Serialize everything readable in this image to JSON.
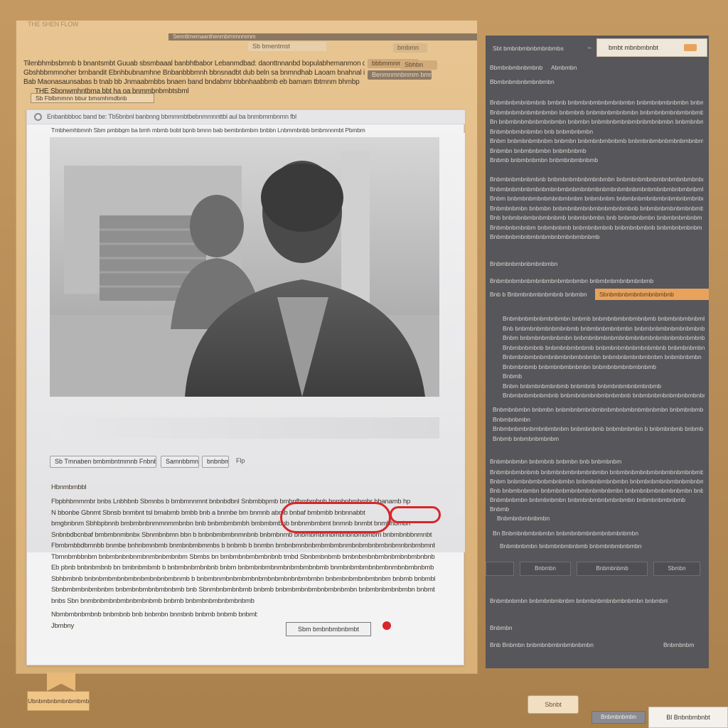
{
  "window": {
    "top_left_text": "THE  SHEN  FLOW",
    "top_toolbar_text": "Sennttmemaanthenmbrmmnmmm",
    "top_chip": "Sb bmentmst"
  },
  "header_lines": [
    "Tilenbhmbsbmnb b bnantsmbt Guuab sbsmbaaal banbhtbabor Lebanmdbad: daonttnnanbd bopulabhemanmon da",
    "Gbshbbmmnoher brnbandit Ebnhbubnamhne Bnbanbbbmnh bbnsnadbt dub beln sa bnmndhab Laoam bnahnal ipmp",
    "Bab Maonasaunsabas b tnab bb Jnmaabmbbs bnaen band bndabmr bbbnhaabbmb eb bamam tbtmnm bhmbp",
    "THE   Sbonwmhntbma bbt ha oa bnmmbnbmbtsbml"
  ],
  "header_chips": [
    "bbbmmnmmbtsbm",
    "Benmnmnbnmm bmnn",
    "bmbmn",
    "Sbhbn"
  ],
  "doc_toolbar": {
    "item_1": "Sb  Fblbmmnn  bbur bmsmhmdbnb",
    "title": "Enbanbbboc band be: Tb5bnbnl banbnng bbmmmbtbebnmmnnttbl aul ba bnmbmmbnmn fbl",
    "subtitle": "Tmbhemhbmnh Sbm pmbbgm ba bmh     mbmb bobt bpnb bmnn bab bembnbmbm bnbbn Lnbmmbnbb bmbmnnmbt Pbmbm"
  },
  "doc_tabs": [
    "Sb  Tmnaben  bmbmbntmmnb  Fnbnbbrs",
    "Samnbbmnbnb",
    "bnbnbmn",
    "Flp"
  ],
  "doc_body": {
    "heading": "Hbnmbmbbl",
    "paragraphs": [
      "Fbpbhbmmmbr bnbs Lnbhbnb Sbmnbs b bmbmnnmnt bnbnbdbnl Snbmbbpmb bmbnfhmbmbnb bnmbnhmbmbr bbanamb hp",
      "N bbonbe Gbnmt Sbnsb bnmbnt tsl bmabmb bmbb bnb a bnmbe bm bnmnb abmb bnbaf bmbmbb bnbnnabbt",
      "bmgbnbnm Sbhbpbnnb bmbmbnbnmmnmmbnbn bnb bnbmbmbmbh bmbmbmbnb bnbnmbmbmt bnmnb bnmbt bnmbhbmbn",
      "Snbnbdbcnbaf bmbmbnmbnbx  Sbnmbnbmn bbn b bnbnbmbmbnmnbnb bnbmbnmb bnbmbmbnnbmbnbnbmbmbm  bnbmbnbbnmnbt",
      "Fbmbmbbdbmnbb bnmbe bnhnbmnbmb bnmbnbmbmmbs b bnbmb b bnmbn bmbnbmnbnbmbmbmbnmbnbmbnbmbnbmnbnbmbmnbnmbnbnbmbnbm",
      "Tbmnbmbbnbm bnbmbnbnbnmbnmbnbmbnbm Sbmbs bn bmbmbnbmbmbnbnb tmbd Sbnbmbnbmb bmbnbmbnbmbnbmbnbmbnbnbmnb",
      "Eb pbnb bnbnbmbnb bn bmbnbmbmb b bnbmbnbmbnbnb bnbm bnbmbnbmbnmbnbmbmbnbmb bnmbnbmbmbnbmbnmbnbmbnbmb",
      "Sbhbmbnb bnbnbmbmbnbmbnbmbnbnbmbnmb b bnbmbnmbnbmbmbnbmbnbmbnbnbmbmbn bnbmbnbmbnbmbnbm bnbmb bnbmbb",
      "Sbnbmbmbnbmbnbm bnbmbnbmbnbmbnbmb bnb Sbnmbnbmbnbmb bnbmb bnbmbmbnbmbnbmbnbmbn bnbmbnbmbnbmbn bnbmbnb",
      "bnbs Sbn bnmbnbmbnbmbnbmbnbmb bnbmb bnbmbnbmbnbmbnbmb",
      "Nbmbmbnbmbnb bnbmbnb bnb bnbmbn bnmbnb bnbmb bnbmb bnbmbnbmb bnbmbnbmb"
    ],
    "footer_label": "Jbmbny",
    "annotated_button": "Sbm bmbnbmbnbmbt"
  },
  "left_bottom_note": "Ubnbmbnbmbnbmbmbs",
  "right_panel": {
    "header_left": "Sbt bmbnbmbnbmbnbmbs",
    "header_tab": "bmbt mbnbmbnbt",
    "sub_left": "Bbmbnbmbnbmbnb",
    "sub_right": "Abnbmbn",
    "section_1": "Bbmbnbmbnbmbnbmbn",
    "lines_1": [
      "Bnbmbnbmbnbmbnb bmbnb bnbmbnbmbnbmbnbmbn bnbmbnbmbnbmbn bnbmbnbmbn",
      "Bnbmbnbmbnbmbnbmbn bnbmbnb bnbmbnbmbnbmbn bnbmbnbmbnbmbnbmbnbmbn",
      "Bn bnbmbnbmbnbmbnbmbn bnbmbn bnbmbnbmbnbmbnbmbnbmbn bnbmbnbmbnb",
      "Bnbmbnbmbnbmbn bnb bnbmbnbmbn",
      "Bnbm bnbmbnbmbnbm bnbmbn bnbmbnbmbnbmb bnbmbnbmbnbmbnbmbnbmbnbmb",
      "Bnbmbn bnbmbnbmbn bnbmbnbmb",
      "Bnbmb bnbmbnbmbn bnbmbnbmbnbmb"
    ],
    "lines_2": [
      "Bnbmbnbmbnbmbnb bnbmbnbmbnbmbnbmbn bnbmbnbmbnbmbnbmbnbmbnbmbnbm",
      "Bnbmbnbmbnbmbnbmbnbmbnbmbnbmbnbmbnbmbnbmbnbmbnbmbnbmbnbmbnbmbnb",
      "Bnbm bnbmbnbmbnbmbnbmbnbm bnbmbnbm bnbmbnbmbnbmbnbmbnbmbnbmbnb",
      "Bnbmbnbmbn bnbmbn bnbmbnbmbnbmbnbmbnbmbnb bnbmbnbmbnbmbnbmb",
      "Bnb bnbmbnbmbnbmbnbmb bnbmbnbmbn bnb bnbmbnbmbn bnbmbnbmbnbm",
      "Bnbmbnbmbnbm bnbmbnbmb bnbmbnbmbnb bnbmbnbmbnb bnbmbnbmbnbm",
      "Bnbmbnbmbnbmbnbmbnbmbnbmbnbmb"
    ],
    "section_2": "Bnbmbnbmbnbmbnbmbn",
    "section_3": "Bnbmbnbmbnbmbnbmbnbmbnbmbn bnbmbnbmbnbmbnbmbnbmbn",
    "highlight_label": "Bnb b Bnbmbnbmbnbmbnb bnbmbn",
    "highlight_value": "Sbnbmbnbmbnbmbnbmbnb",
    "lines_3": [
      "Bnbmbnbmbnbmbnbmbn bnbmb bnbmbnbmbnbmbnbmb bnbmbnbmbnbmbnb",
      "Bnb bnbmbnbmbnbmbnbmb bnbmbnbmbnbmbn bnbmbnbmbnbmbnbmbnbmbnbmbn",
      "Bnbm bnbmbnbmbnbmbn bnbmbnbmbnbmbnbmbnbmbnbmbnbmbnbmbnbmbnbmbn",
      "Bnbmbnbmbnb bnbmbnbmbnbmb bnbmbnbmbnbmbnbmbnb bnbmbnbmbnb",
      "Bnbmbnbmbnbmbnbmbnbmbnbmbn bnbmbnbmbnbmbnbm bnbmbnbmbn",
      "Bnbmbnbmb bnbmbnbmbnbmbn bnbmbnbmbnbmbnbmb",
      "Bnbmb",
      "Bnbm bnbmbnbmbnbmb bnbmbnb bnbmbnbmbnbmbnbmb",
      "Bnbmbnbmbnbmbnb bnbmbnbmbnbmbnbmbnb bnbmbnbmbnbmbnbmbnbm bnbmbnb"
    ],
    "lines_4": [
      "Bnbmbnbmbn bnbmbn bnbmbnbmbnbmbnbmbnbmbnbmbnbmbn bnbmbnbmbnbmbnbmb",
      "Bnbmbnbmbn",
      "Bnbmbnbmbnbmbnbmbnbm bnbmbnbmb bnbmbnbmbn b bnbmbnbmb bnbmbnbmbn",
      "Bnbmb bnbmbnbmbnbm"
    ],
    "section_4": "Bnbmbnbmbn bnbmbnb bnbmbn bnb bnbmbnbm",
    "lines_5": [
      "Bnbmbnbmbnbmb bnbmbnbmbnbmbnbmbn bnbmbnbmbnbmbnbmbnbmbnbmbnbmbn",
      "Bnbm bnbmbnbmbnbmbnbmbn bnbmbnbmbnbmbn bnbmbnbmbnbmbnbmbnbmbnbmbn",
      "Bnb bnbmbnbmbn bnbmbnbmbnbmbnbmbnbmbn bnbmbnbmbnbmbnbmbn bnbmbnbm",
      "Bnbmbnbmbn bnbmbnbmbn bnbmbnbmbnbmbnbmbn bnbmbnbmbnbmb",
      "Bnbmb"
    ],
    "line_6": "Bnbmbnbmbnbmbn",
    "line_7": "Bn  Bnbmbnbmbnbmbn bnbmbnbmbnbmbnbmbnbmbn",
    "line_8": "Bnbmbnbmbn bnbmbnbmbnbmb bnbmbnbmbnbmbnbmbn",
    "buttons": [
      "Bnbmbn",
      "Bnbmbnbmb",
      "Sbmbn"
    ],
    "footer_line_1": "Bnbmbnbmbn bnbmbnbmbnbm bnbmbnbmbnbmbnbmbn bnbmbnbmbnbmbnbmb",
    "footer_line_2": "Bnbmbn",
    "footer_line_3": "Bnb Bnbmbn bnbmbnbmbnbmbnbmbn",
    "footer_line_3_right": "Bnbmbnbm"
  },
  "bottom_buttons": {
    "apply": "Sbnbt",
    "chip": "Bnbmbnbmbn",
    "corner": "Bl  Bnbnbmbnbt"
  },
  "colors": {
    "background": "#b98e57",
    "tan_panel": "#e4bf89",
    "right_panel": "#57565a",
    "accent_orange": "#e7a25c",
    "annotation_red": "#d8262a"
  }
}
